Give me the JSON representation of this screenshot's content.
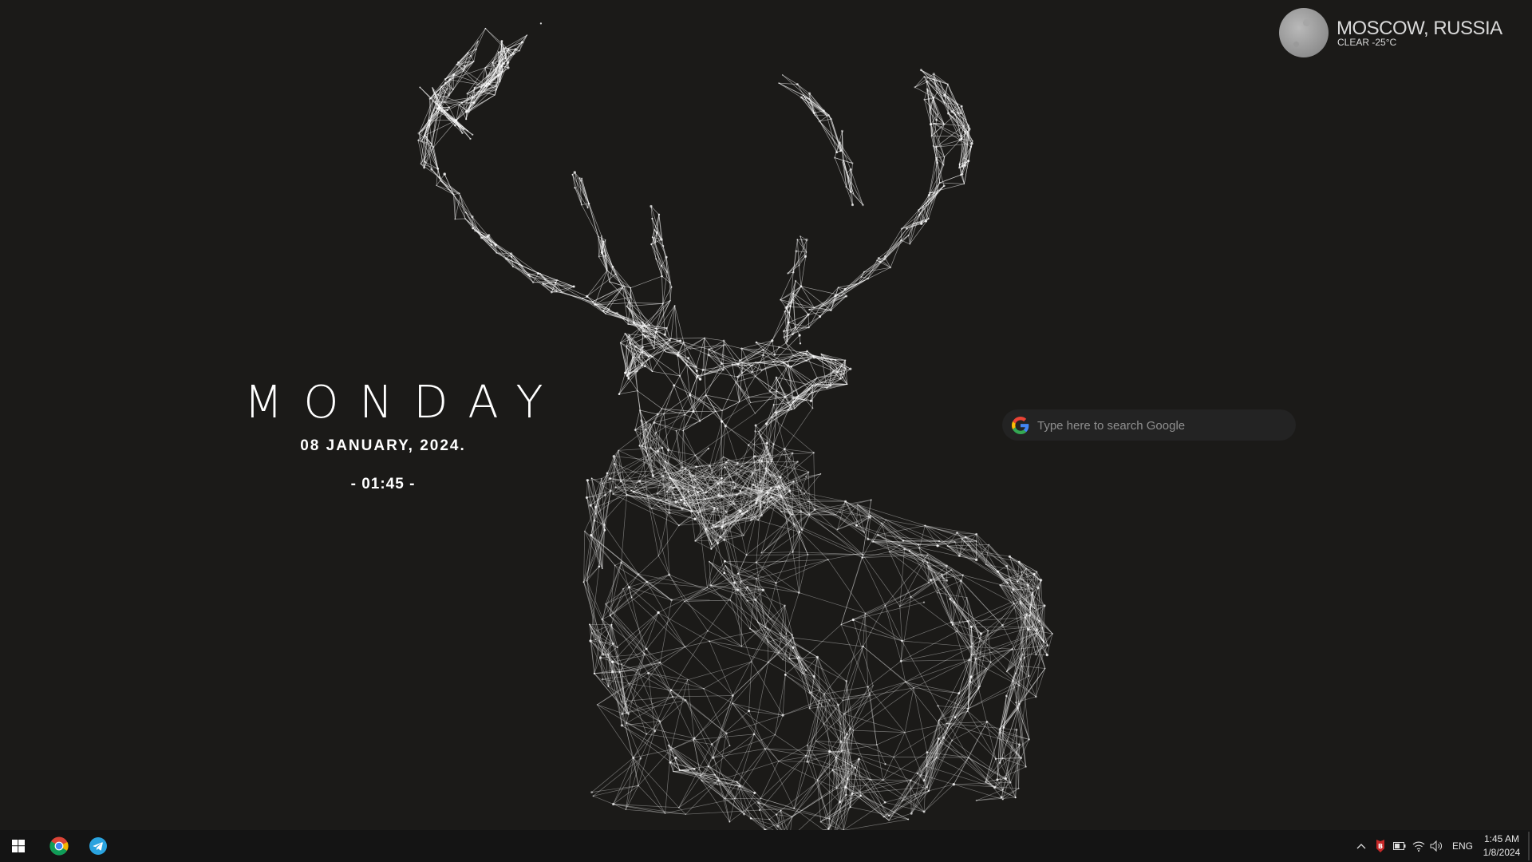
{
  "clock_widget": {
    "day": "MONDAY",
    "date": "08  JANUARY,  2024.",
    "time": "- 01:45 -"
  },
  "weather": {
    "city": "MOSCOW, RUSSIA",
    "condition": "CLEAR -25°C",
    "icon": "moon-icon"
  },
  "search": {
    "placeholder": "Type here to search Google",
    "icon": "google-g-icon"
  },
  "taskbar": {
    "start_icon": "windows-start-icon",
    "pinned_apps": [
      "Google Chrome",
      "Telegram"
    ],
    "tray": {
      "language": "ENG",
      "time": "1:45 AM",
      "date": "1/8/2024",
      "icons": [
        "chevron-up-icon",
        "bitdefender-icon",
        "battery-icon",
        "wifi-icon",
        "volume-icon"
      ]
    }
  },
  "colors": {
    "background": "#1b1a18",
    "taskbar": "#141414",
    "search_bar": "#232323",
    "telegram": "#2aa3df"
  }
}
